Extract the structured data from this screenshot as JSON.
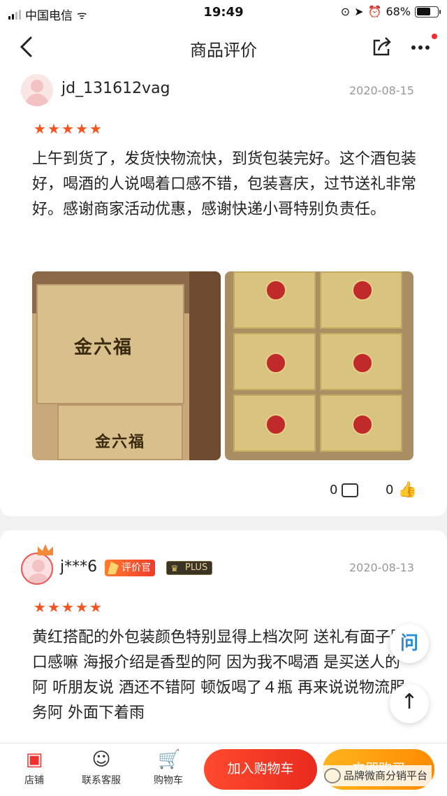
{
  "status_bar": {
    "carrier": "中国电信",
    "time": "19:49",
    "battery": "68%"
  },
  "nav": {
    "title": "商品评价",
    "back_icon": "chevron-left-icon",
    "share_icon": "share-icon",
    "more_icon": "more-icon"
  },
  "reviews": [
    {
      "username": "jd_131612vag",
      "date": "2020-08-15",
      "rating": 5,
      "text": "上午到货了，发货快物流快，到货包装完好。这个酒包装好，喝酒的人说喝着口感不错，包装喜庆，过节送礼非常好。感谢商家活动优惠，感谢快递小哥特别负责任。",
      "photo1_label": "金六福",
      "photo2_label": "金六福",
      "comments": "0",
      "likes": "0"
    },
    {
      "username": "j***6",
      "date": "2020-08-13",
      "rating": 5,
      "badge_reviewer": "评价官",
      "badge_plus": "PLUS",
      "text": "黄红搭配的外包装颜色特别显得上档次阿  送礼有面子阿  口感嘛  海报介绍是香型的阿   因为我不喝酒  是买送人的 阿  听朋友说  酒还不错阿   顿饭喝了４瓶  再来说说物流服务阿   外面下着雨"
    }
  ],
  "float": {
    "ask_label": "问",
    "top_label": "↑"
  },
  "bottom_bar": {
    "tabs": [
      "店铺",
      "联系客服",
      "购物车"
    ],
    "add_cart": "加入购物车",
    "buy_now": "立即购买"
  },
  "watermark": "品牌微商分销平台",
  "colors": {
    "accent": "#f23030",
    "star": "#f5541e",
    "buy": "#ff9a00"
  }
}
